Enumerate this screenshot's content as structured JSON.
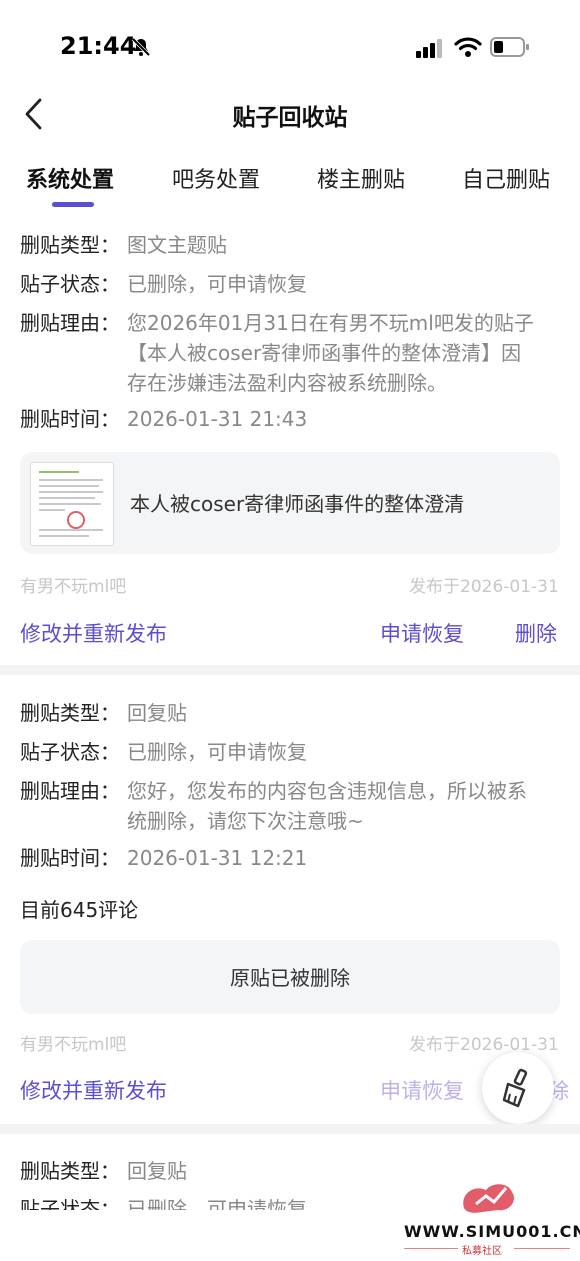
{
  "status_bar": {
    "time": "21:44"
  },
  "nav": {
    "title": "贴子回收站"
  },
  "tabs": [
    "系统处置",
    "吧务处置",
    "楼主删贴",
    "自己删贴"
  ],
  "labels": {
    "type": "删贴类型：",
    "status": "贴子状态：",
    "reason": "删贴理由：",
    "time": "删贴时间："
  },
  "posts": [
    {
      "type": "图文主题贴",
      "status": "已删除，可申请恢复",
      "reason_lines": [
        "您2026年01月31日在有男不玩ml吧发的贴子",
        "【本人被coser寄律师函事件的整体澄清】因",
        "存在涉嫌违法盈利内容被系统删除。"
      ],
      "time": "2026-01-31 21:43",
      "card_title": "本人被coser寄律师函事件的整体澄清",
      "forum": "有男不玩ml吧",
      "posted": "发布于2026-01-31",
      "actions": {
        "edit": "修改并重新发布",
        "restore": "申请恢复",
        "delete": "删除"
      }
    },
    {
      "type": "回复贴",
      "status": "已删除，可申请恢复",
      "reason_lines": [
        "您好，您发布的内容包含违规信息，所以被系",
        "统删除，请您下次注意哦~"
      ],
      "time": "2026-01-31 12:21",
      "comments": "目前645评论",
      "card_title": "原贴已被删除",
      "forum": "有男不玩ml吧",
      "posted": "发布于2026-01-31",
      "actions": {
        "edit": "修改并重新发布",
        "restore": "申请恢复",
        "delete": "除"
      }
    },
    {
      "type": "回复贴",
      "status": "已删除，可申请恢复"
    }
  ],
  "watermark": {
    "text": "WWW.SIMU001.CN",
    "sub": "私募社区"
  },
  "colors": {
    "accent": "#5b4fcf",
    "muted": "#888888",
    "card": "#f4f5f7"
  },
  "icons": [
    "notifications-off-icon",
    "signal-icon",
    "wifi-icon",
    "battery-icon",
    "back-chevron-icon",
    "broom-icon"
  ]
}
